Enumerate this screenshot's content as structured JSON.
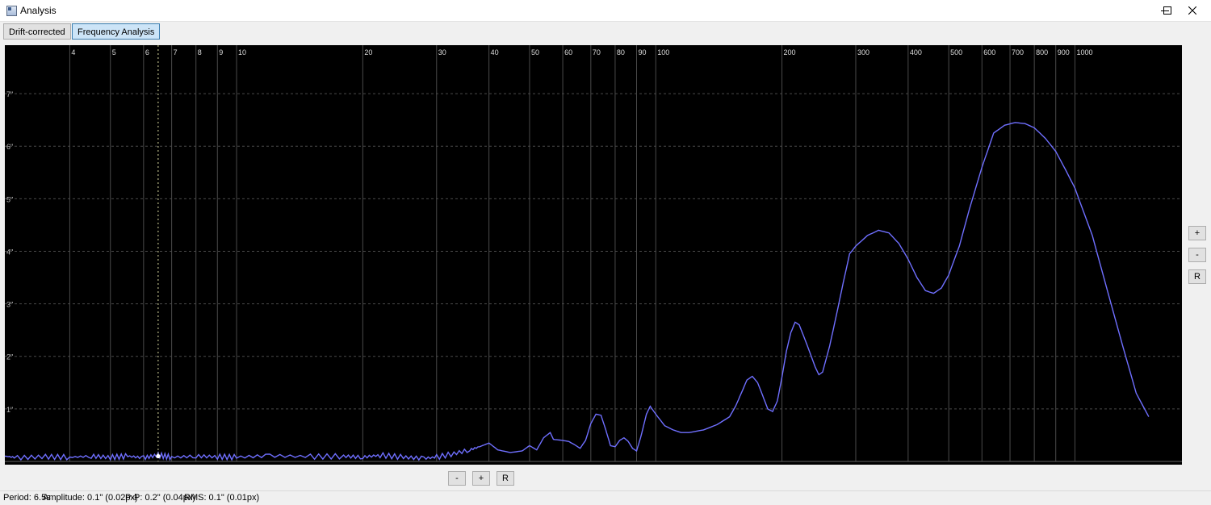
{
  "window": {
    "title": "Analysis",
    "controls": {
      "minimize": "minimize-icon",
      "maximize": "maximize-icon",
      "close": "close-icon"
    }
  },
  "tabs": [
    {
      "label": "Drift-corrected",
      "active": false
    },
    {
      "label": "Frequency Analysis",
      "active": true
    }
  ],
  "zoom_controls": {
    "vertical": {
      "plus": "+",
      "minus": "-",
      "reset": "R"
    },
    "horizontal": {
      "minus": "-",
      "plus": "+",
      "reset": "R"
    }
  },
  "status_bar": {
    "period": "Period: 6.5s",
    "amplitude": "Amplitude: 0.1\" (0.02px)",
    "peak_to_peak": "P-P: 0.2\" (0.04px)",
    "rms": "RMS: 0.1\" (0.01px)"
  },
  "colors": {
    "plot_background": "#000000",
    "trace": "#6f6fff",
    "grid": "#4a4a4a",
    "cursor": "#d8d8a0"
  },
  "chart_data": {
    "type": "line",
    "x_scale": "log",
    "xlabel": "",
    "ylabel": "",
    "x_ticks": [
      {
        "value": 4,
        "label": "4"
      },
      {
        "value": 5,
        "label": "5"
      },
      {
        "value": 6,
        "label": "6"
      },
      {
        "value": 7,
        "label": "7"
      },
      {
        "value": 8,
        "label": "8"
      },
      {
        "value": 9,
        "label": "9"
      },
      {
        "value": 10,
        "label": "10"
      },
      {
        "value": 20,
        "label": "20"
      },
      {
        "value": 30,
        "label": "30"
      },
      {
        "value": 40,
        "label": "40"
      },
      {
        "value": 50,
        "label": "50"
      },
      {
        "value": 60,
        "label": "60"
      },
      {
        "value": 70,
        "label": "70"
      },
      {
        "value": 80,
        "label": "80"
      },
      {
        "value": 90,
        "label": "90"
      },
      {
        "value": 100,
        "label": "100"
      },
      {
        "value": 200,
        "label": "200"
      },
      {
        "value": 300,
        "label": "300"
      },
      {
        "value": 400,
        "label": "400"
      },
      {
        "value": 500,
        "label": "500"
      },
      {
        "value": 600,
        "label": "600"
      },
      {
        "value": 700,
        "label": "700"
      },
      {
        "value": 800,
        "label": "800"
      },
      {
        "value": 900,
        "label": "900"
      },
      {
        "value": 1000,
        "label": "1000"
      }
    ],
    "y_ticks": [
      {
        "value": 1,
        "label": "1\""
      },
      {
        "value": 2,
        "label": "2\""
      },
      {
        "value": 3,
        "label": "3\""
      },
      {
        "value": 4,
        "label": "4\""
      },
      {
        "value": 5,
        "label": "5\""
      },
      {
        "value": 6,
        "label": "6\""
      },
      {
        "value": 7,
        "label": "7\""
      }
    ],
    "xlim": [
      2.8,
      1800
    ],
    "ylim": [
      0,
      7.8
    ],
    "cursor": {
      "x": 6.5,
      "y": 0.1
    },
    "series": [
      {
        "color": "#6f6fff",
        "points": [
          [
            2.8,
            0.1
          ],
          [
            3,
            0.07
          ],
          [
            3.5,
            0.09
          ],
          [
            4,
            0.08
          ],
          [
            4.5,
            0.1
          ],
          [
            5,
            0.08
          ],
          [
            5.5,
            0.1
          ],
          [
            6,
            0.07
          ],
          [
            6.5,
            0.12
          ],
          [
            7,
            0.08
          ],
          [
            8,
            0.1
          ],
          [
            9,
            0.09
          ],
          [
            10,
            0.08
          ],
          [
            12,
            0.11
          ],
          [
            15,
            0.09
          ],
          [
            18,
            0.1
          ],
          [
            20,
            0.08
          ],
          [
            22,
            0.12
          ],
          [
            25,
            0.08
          ],
          [
            28,
            0.06
          ],
          [
            30,
            0.08
          ],
          [
            33,
            0.15
          ],
          [
            36,
            0.22
          ],
          [
            38,
            0.28
          ],
          [
            40,
            0.35
          ],
          [
            42,
            0.22
          ],
          [
            45,
            0.17
          ],
          [
            48,
            0.2
          ],
          [
            50,
            0.3
          ],
          [
            52,
            0.22
          ],
          [
            54,
            0.45
          ],
          [
            56,
            0.55
          ],
          [
            57,
            0.42
          ],
          [
            60,
            0.4
          ],
          [
            62,
            0.38
          ],
          [
            64,
            0.32
          ],
          [
            66,
            0.25
          ],
          [
            68,
            0.4
          ],
          [
            70,
            0.72
          ],
          [
            72,
            0.9
          ],
          [
            74,
            0.88
          ],
          [
            76,
            0.6
          ],
          [
            78,
            0.3
          ],
          [
            80,
            0.28
          ],
          [
            82,
            0.4
          ],
          [
            84,
            0.45
          ],
          [
            86,
            0.38
          ],
          [
            88,
            0.25
          ],
          [
            90,
            0.2
          ],
          [
            92,
            0.45
          ],
          [
            95,
            0.9
          ],
          [
            97,
            1.05
          ],
          [
            100,
            0.9
          ],
          [
            105,
            0.68
          ],
          [
            110,
            0.6
          ],
          [
            115,
            0.55
          ],
          [
            120,
            0.55
          ],
          [
            130,
            0.6
          ],
          [
            140,
            0.7
          ],
          [
            150,
            0.85
          ],
          [
            155,
            1.05
          ],
          [
            160,
            1.3
          ],
          [
            165,
            1.55
          ],
          [
            170,
            1.62
          ],
          [
            175,
            1.5
          ],
          [
            180,
            1.25
          ],
          [
            185,
            1.0
          ],
          [
            190,
            0.95
          ],
          [
            195,
            1.15
          ],
          [
            200,
            1.6
          ],
          [
            205,
            2.1
          ],
          [
            210,
            2.45
          ],
          [
            215,
            2.65
          ],
          [
            220,
            2.6
          ],
          [
            230,
            2.2
          ],
          [
            240,
            1.8
          ],
          [
            245,
            1.65
          ],
          [
            250,
            1.7
          ],
          [
            260,
            2.2
          ],
          [
            270,
            2.8
          ],
          [
            280,
            3.4
          ],
          [
            290,
            3.95
          ],
          [
            300,
            4.1
          ],
          [
            320,
            4.3
          ],
          [
            340,
            4.4
          ],
          [
            360,
            4.35
          ],
          [
            380,
            4.15
          ],
          [
            400,
            3.85
          ],
          [
            420,
            3.5
          ],
          [
            440,
            3.25
          ],
          [
            460,
            3.2
          ],
          [
            480,
            3.3
          ],
          [
            500,
            3.55
          ],
          [
            530,
            4.1
          ],
          [
            560,
            4.8
          ],
          [
            600,
            5.6
          ],
          [
            640,
            6.25
          ],
          [
            680,
            6.4
          ],
          [
            720,
            6.45
          ],
          [
            760,
            6.43
          ],
          [
            800,
            6.35
          ],
          [
            850,
            6.15
          ],
          [
            900,
            5.9
          ],
          [
            950,
            5.55
          ],
          [
            1000,
            5.2
          ],
          [
            1100,
            4.3
          ],
          [
            1200,
            3.2
          ],
          [
            1300,
            2.2
          ],
          [
            1400,
            1.3
          ],
          [
            1500,
            0.85
          ]
        ]
      }
    ]
  }
}
